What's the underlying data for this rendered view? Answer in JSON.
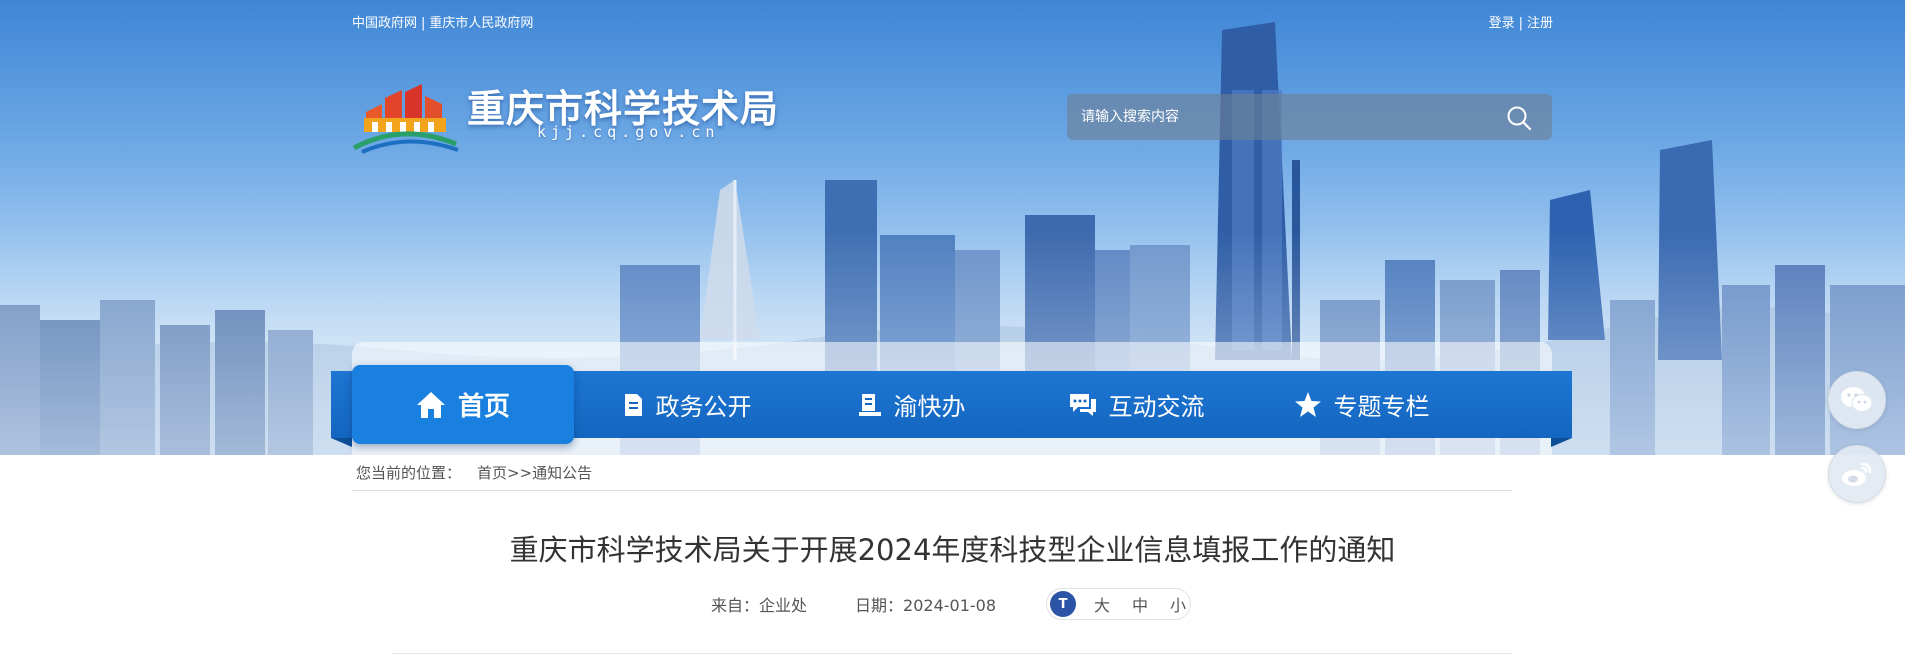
{
  "top_links": {
    "gov_cn": "中国政府网",
    "separator": "|",
    "cq_gov": "重庆市人民政府网"
  },
  "user_links": {
    "login": "登录",
    "separator": "|",
    "register": "注册"
  },
  "header": {
    "site_title": "重庆市科学技术局",
    "site_domain": "kjj.cq.gov.cn",
    "logo_icon": "chongqing-government-emblem",
    "banner_image": "chongqing-city-skyline"
  },
  "search": {
    "placeholder": "请输入搜索内容",
    "icon": "search-icon"
  },
  "nav": {
    "items": [
      {
        "label": "首页",
        "icon": "home-icon",
        "active": true
      },
      {
        "label": "政务公开",
        "icon": "document-icon",
        "active": false
      },
      {
        "label": "渝快办",
        "icon": "service-desk-icon",
        "active": false
      },
      {
        "label": "互动交流",
        "icon": "chat-icon",
        "active": false
      },
      {
        "label": "专题专栏",
        "icon": "star-icon",
        "active": false
      }
    ]
  },
  "share": {
    "wechat_icon": "wechat-icon",
    "weibo_icon": "weibo-icon"
  },
  "breadcrumb": {
    "prefix": "您当前的位置：",
    "home": "首页",
    "separator": ">>",
    "current": "通知公告"
  },
  "article": {
    "title": "重庆市科学技术局关于开展2024年度科技型企业信息填报工作的通知",
    "source_label": "来自：",
    "source_value": "企业处",
    "date_label": "日期：",
    "date_value": "2024-01-08",
    "font_size": {
      "icon_text": "T",
      "large": "大",
      "medium": "中",
      "small": "小"
    }
  },
  "colors": {
    "nav_blue": "#1466c0",
    "nav_active": "#1a80e0",
    "font_icon_bg": "#2b54a6"
  }
}
